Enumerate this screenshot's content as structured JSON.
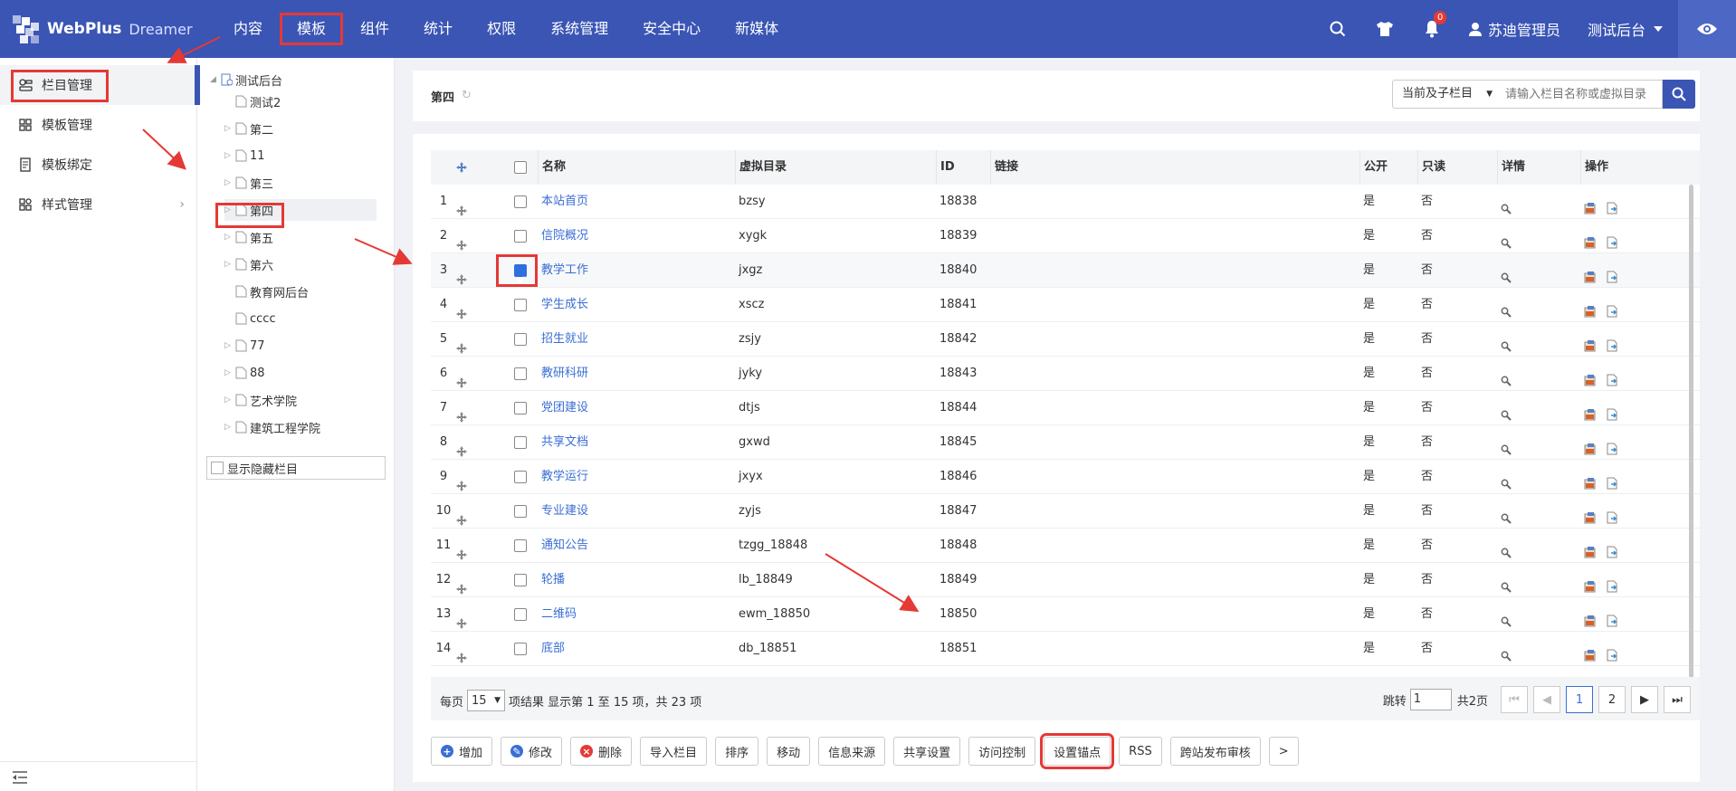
{
  "app": {
    "brand": "WebPlus",
    "product": "Dreamer"
  },
  "nav": [
    "内容",
    "模板",
    "组件",
    "统计",
    "权限",
    "系统管理",
    "安全中心",
    "新媒体"
  ],
  "notifications": "0",
  "user": "苏迪管理员",
  "site": "测试后台",
  "sidebar": [
    "栏目管理",
    "模板管理",
    "模板绑定",
    "样式管理"
  ],
  "tree": {
    "root": "测试后台",
    "nodes": [
      "测试2",
      "第二",
      "11",
      "第三",
      "第四",
      "第五",
      "第六",
      "教育网后台",
      "cccc",
      "77",
      "88",
      "艺术学院",
      "建筑工程学院"
    ],
    "show_hidden": "显示隐藏栏目"
  },
  "page": {
    "title": "第四"
  },
  "search": {
    "scope": "当前及子栏目",
    "placeholder": "请输入栏目名称或虚拟目录"
  },
  "table": {
    "headers": {
      "name": "名称",
      "dir": "虚拟目录",
      "id": "ID",
      "link": "链接",
      "public": "公开",
      "readonly": "只读",
      "detail": "详情",
      "ops": "操作"
    },
    "rows": [
      {
        "n": "1",
        "name": "本站首页",
        "dir": "bzsy",
        "id": "18838",
        "pub": "是",
        "ro": "否"
      },
      {
        "n": "2",
        "name": "信院概况",
        "dir": "xygk",
        "id": "18839",
        "pub": "是",
        "ro": "否"
      },
      {
        "n": "3",
        "name": "教学工作",
        "dir": "jxgz",
        "id": "18840",
        "pub": "是",
        "ro": "否"
      },
      {
        "n": "4",
        "name": "学生成长",
        "dir": "xscz",
        "id": "18841",
        "pub": "是",
        "ro": "否"
      },
      {
        "n": "5",
        "name": "招生就业",
        "dir": "zsjy",
        "id": "18842",
        "pub": "是",
        "ro": "否"
      },
      {
        "n": "6",
        "name": "教研科研",
        "dir": "jyky",
        "id": "18843",
        "pub": "是",
        "ro": "否"
      },
      {
        "n": "7",
        "name": "党团建设",
        "dir": "dtjs",
        "id": "18844",
        "pub": "是",
        "ro": "否"
      },
      {
        "n": "8",
        "name": "共享文档",
        "dir": "gxwd",
        "id": "18845",
        "pub": "是",
        "ro": "否"
      },
      {
        "n": "9",
        "name": "教学运行",
        "dir": "jxyx",
        "id": "18846",
        "pub": "是",
        "ro": "否"
      },
      {
        "n": "10",
        "name": "专业建设",
        "dir": "zyjs",
        "id": "18847",
        "pub": "是",
        "ro": "否"
      },
      {
        "n": "11",
        "name": "通知公告",
        "dir": "tzgg_18848",
        "id": "18848",
        "pub": "是",
        "ro": "否"
      },
      {
        "n": "12",
        "name": "轮播",
        "dir": "lb_18849",
        "id": "18849",
        "pub": "是",
        "ro": "否"
      },
      {
        "n": "13",
        "name": "二维码",
        "dir": "ewm_18850",
        "id": "18850",
        "pub": "是",
        "ro": "否"
      },
      {
        "n": "14",
        "name": "底部",
        "dir": "db_18851",
        "id": "18851",
        "pub": "是",
        "ro": "否"
      }
    ]
  },
  "pager": {
    "per_page": "每页",
    "size": "15",
    "summary": "项结果 显示第 1 至 15 项，共 23 项",
    "jump": "跳转",
    "jump_value": "1",
    "total_pages": "共2页",
    "pages": [
      "1",
      "2"
    ]
  },
  "toolbar": [
    "增加",
    "修改",
    "删除",
    "导入栏目",
    "排序",
    "移动",
    "信息来源",
    "共享设置",
    "访问控制",
    "设置锚点",
    "RSS",
    "跨站发布审核",
    ">"
  ]
}
